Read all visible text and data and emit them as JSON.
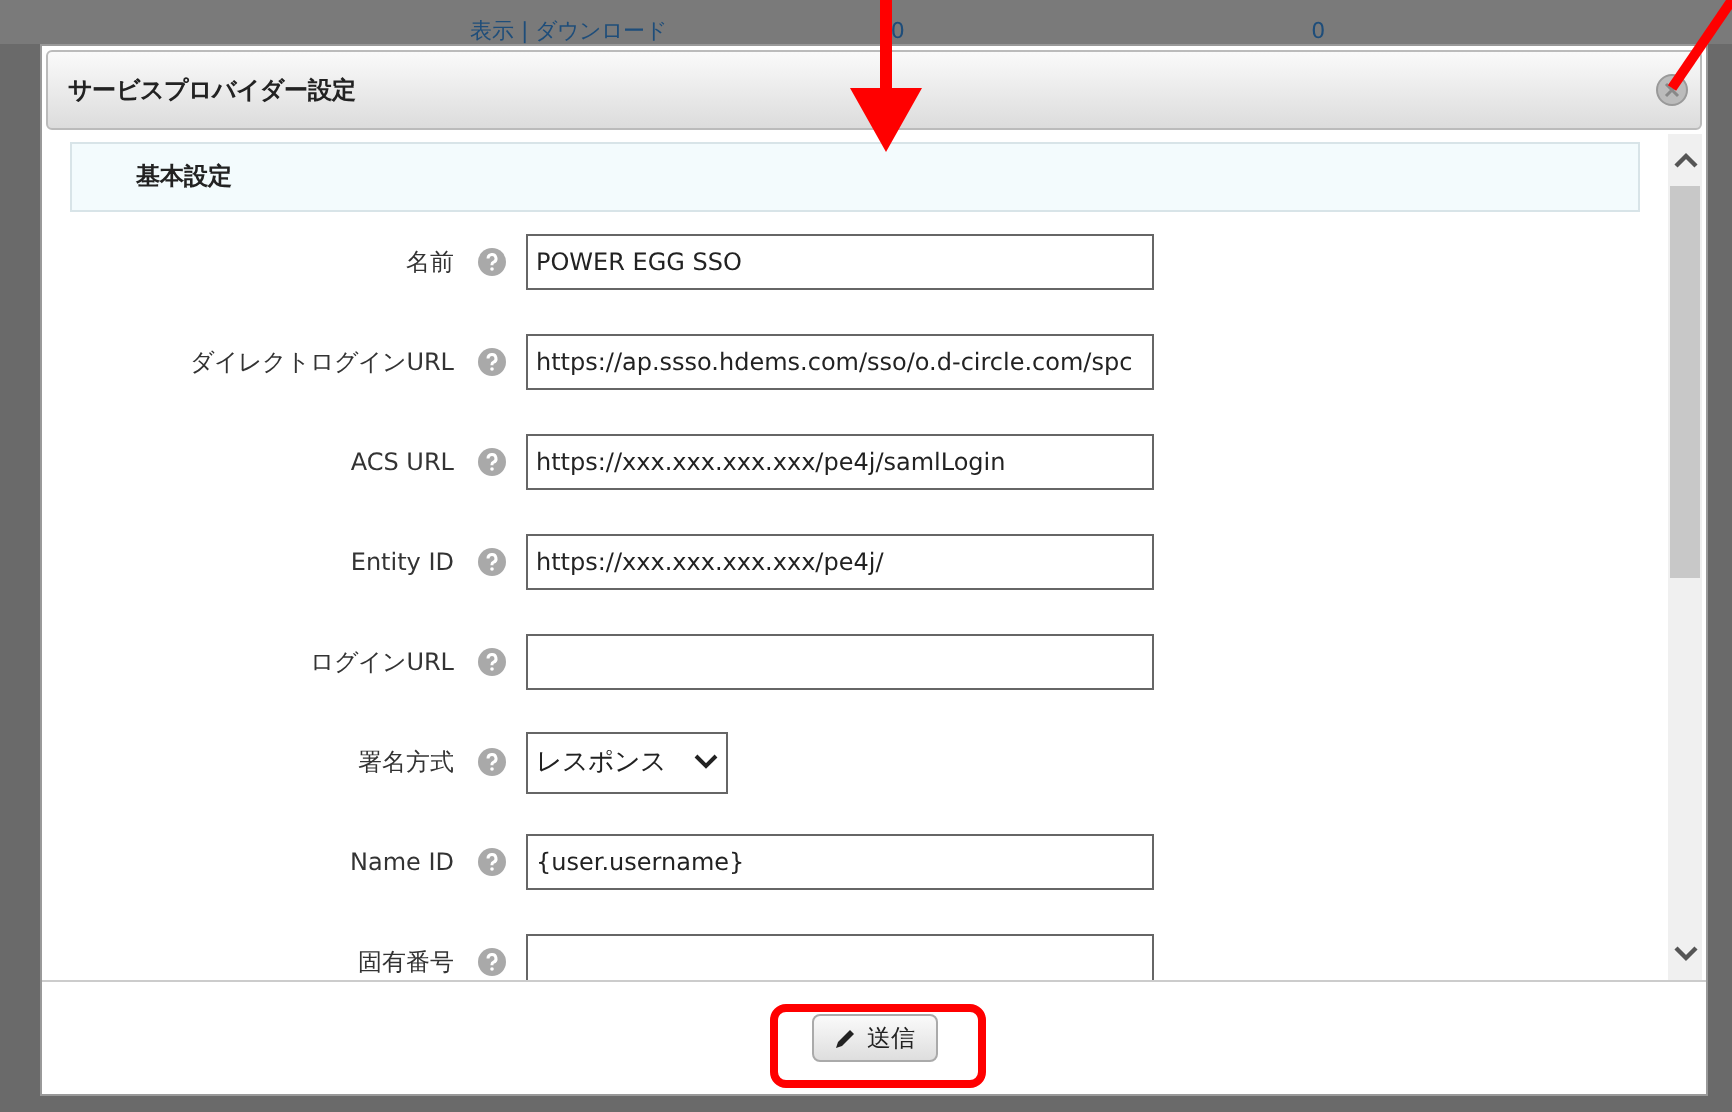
{
  "background_table": {
    "cells": [
      "表示 | ダウンロード",
      "0",
      "0"
    ]
  },
  "dialog": {
    "title": "サービスプロバイダー設定",
    "section": "基本設定",
    "fields": [
      {
        "kind": "text",
        "label": "名前",
        "value": "POWER EGG SSO"
      },
      {
        "kind": "text",
        "label": "ダイレクトログインURL",
        "value": "https://ap.ssso.hdems.com/sso/o.d-circle.com/spc"
      },
      {
        "kind": "text",
        "label": "ACS URL",
        "value": "https://xxx.xxx.xxx.xxx/pe4j/samlLogin"
      },
      {
        "kind": "text",
        "label": "Entity ID",
        "value": "https://xxx.xxx.xxx.xxx/pe4j/"
      },
      {
        "kind": "text",
        "label": "ログインURL"
      },
      {
        "kind": "select",
        "label": "署名方式",
        "value": "レスポンス"
      },
      {
        "kind": "text",
        "label": "Name ID",
        "value": "{user.username}"
      },
      {
        "kind": "text",
        "label": "固有番号"
      }
    ],
    "submit": "送信"
  }
}
